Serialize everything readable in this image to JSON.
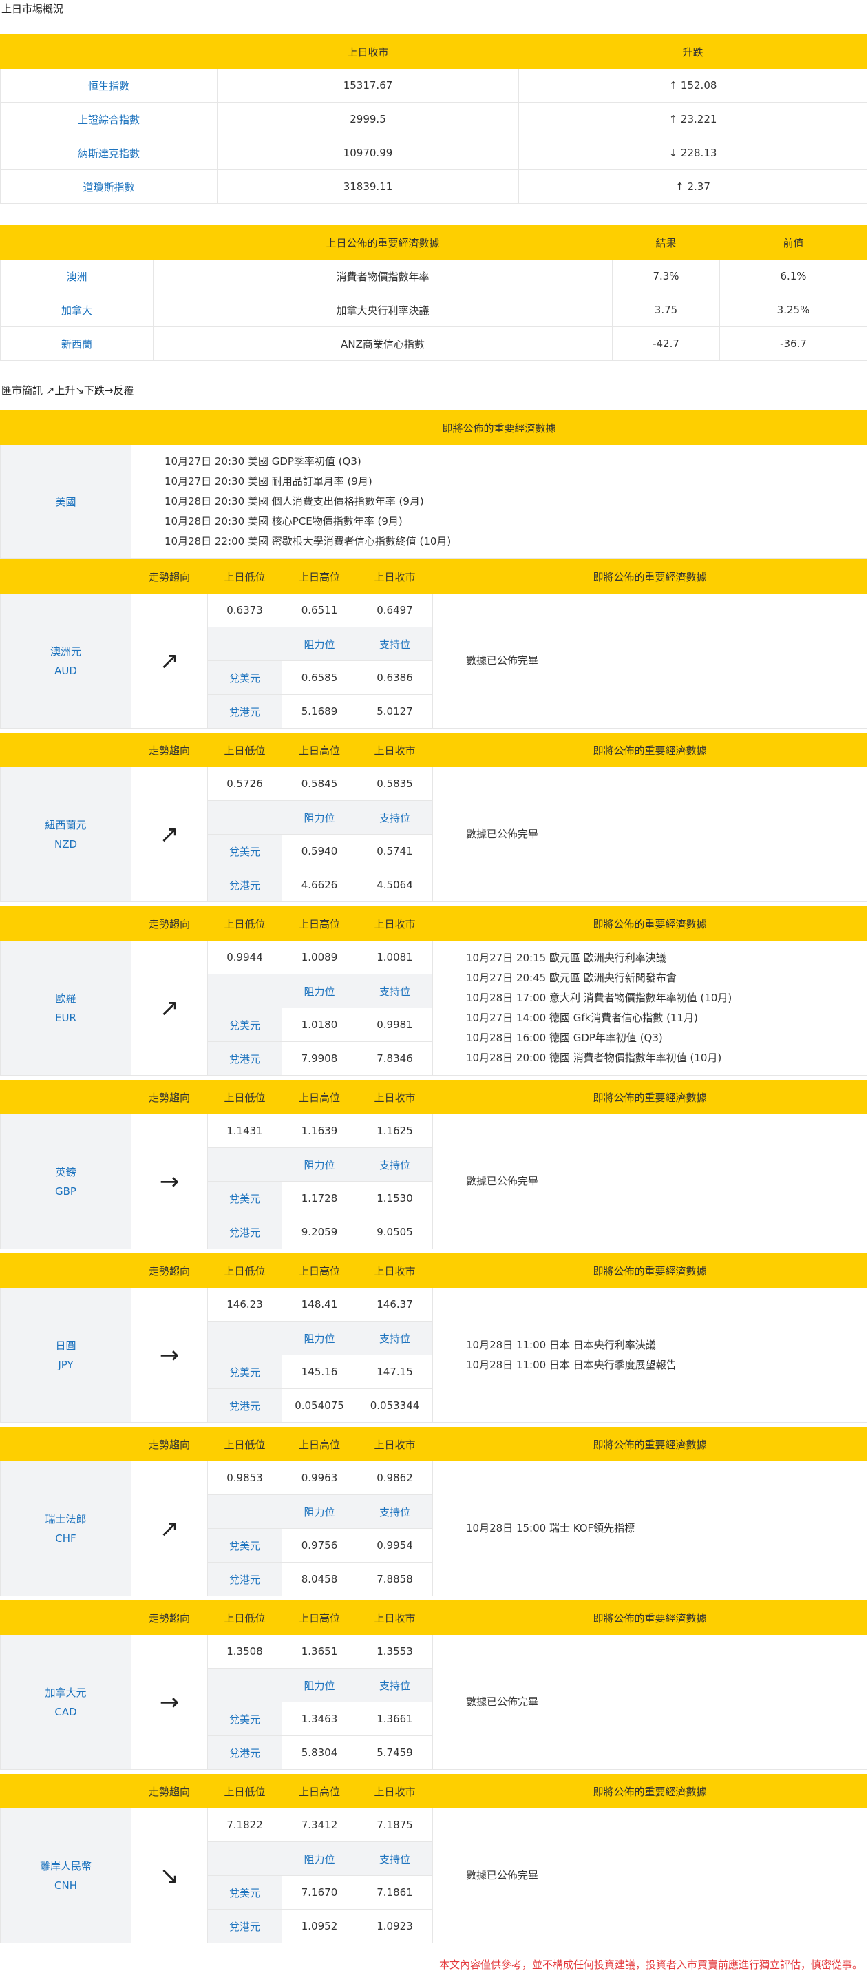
{
  "market": {
    "title": "上日市場概況",
    "headers": [
      "",
      "上日收市",
      "升跌"
    ],
    "rows": [
      {
        "name": "恒生指數",
        "close": "15317.67",
        "change": "↑ 152.08"
      },
      {
        "name": "上證綜合指數",
        "close": "2999.5",
        "change": "↑ 23.221"
      },
      {
        "name": "納斯達克指數",
        "close": "10970.99",
        "change": "↓ 228.13"
      },
      {
        "name": "道瓊斯指數",
        "close": "31839.11",
        "change": "↑ 2.37"
      }
    ]
  },
  "econ": {
    "headers": [
      "",
      "上日公佈的重要經濟數據",
      "結果",
      "前值"
    ],
    "rows": [
      {
        "country": "澳洲",
        "item": "消費者物價指數年率",
        "result": "7.3%",
        "prev": "6.1%"
      },
      {
        "country": "加拿大",
        "item": "加拿大央行利率決議",
        "result": "3.75",
        "prev": "3.25%"
      },
      {
        "country": "新西蘭",
        "item": "ANZ商業信心指數",
        "result": "-42.7",
        "prev": "-36.7"
      }
    ]
  },
  "fx": {
    "title": "匯市簡訊 ↗上升↘下跌→反覆",
    "upcoming_header": "即將公佈的重要經濟數據",
    "us": {
      "label": "美國",
      "events": [
        "10月27日 20:30  美國 GDP季率初值 (Q3)",
        "10月27日 20:30  美國 耐用品訂單月率 (9月)",
        "10月28日 20:30  美國 個人消費支出價格指數年率 (9月)",
        "10月28日 20:30  美國 核心PCE物價指數年率 (9月)",
        "10月28日 22:00  美國 密歇根大學消費者信心指數終值 (10月)"
      ]
    },
    "col_headers": [
      "走勢趨向",
      "上日低位",
      "上日高位",
      "上日收市",
      "即將公佈的重要經濟數據"
    ],
    "sub_headers": [
      "阻力位",
      "支持位"
    ],
    "row_labels": [
      "兌美元",
      "兌港元"
    ],
    "currencies": [
      {
        "name": "澳洲元",
        "code": "AUD",
        "trend": "↗",
        "low": "0.6373",
        "high": "0.6511",
        "close": "0.6497",
        "usd_res": "0.6585",
        "usd_sup": "0.6386",
        "hkd_res": "5.1689",
        "hkd_sup": "5.0127",
        "events": [
          "數據已公佈完畢"
        ]
      },
      {
        "name": "紐西蘭元",
        "code": "NZD",
        "trend": "↗",
        "low": "0.5726",
        "high": "0.5845",
        "close": "0.5835",
        "usd_res": "0.5940",
        "usd_sup": "0.5741",
        "hkd_res": "4.6626",
        "hkd_sup": "4.5064",
        "events": [
          "數據已公佈完畢"
        ]
      },
      {
        "name": "歐羅",
        "code": "EUR",
        "trend": "↗",
        "low": "0.9944",
        "high": "1.0089",
        "close": "1.0081",
        "usd_res": "1.0180",
        "usd_sup": "0.9981",
        "hkd_res": "7.9908",
        "hkd_sup": "7.8346",
        "events": [
          "10月27日 20:15  歐元區 歐洲央行利率決議",
          "10月27日 20:45  歐元區 歐洲央行新聞發布會",
          "10月28日 17:00  意大利 消費者物價指數年率初值 (10月)",
          "10月27日 14:00  德國 Gfk消費者信心指數 (11月)",
          "10月28日 16:00  德國 GDP年率初值 (Q3)",
          "10月28日 20:00  德國 消費者物價指數年率初值 (10月)"
        ]
      },
      {
        "name": "英鎊",
        "code": "GBP",
        "trend": "→",
        "low": "1.1431",
        "high": "1.1639",
        "close": "1.1625",
        "usd_res": "1.1728",
        "usd_sup": "1.1530",
        "hkd_res": "9.2059",
        "hkd_sup": "9.0505",
        "events": [
          "數據已公佈完畢"
        ]
      },
      {
        "name": "日圓",
        "code": "JPY",
        "trend": "→",
        "low": "146.23",
        "high": "148.41",
        "close": "146.37",
        "usd_res": "145.16",
        "usd_sup": "147.15",
        "hkd_res": "0.054075",
        "hkd_sup": "0.053344",
        "events": [
          "10月28日 11:00  日本 日本央行利率決議",
          "10月28日 11:00  日本 日本央行季度展望報告"
        ]
      },
      {
        "name": "瑞士法郎",
        "code": "CHF",
        "trend": "↗",
        "low": "0.9853",
        "high": "0.9963",
        "close": "0.9862",
        "usd_res": "0.9756",
        "usd_sup": "0.9954",
        "hkd_res": "8.0458",
        "hkd_sup": "7.8858",
        "events": [
          "10月28日 15:00 瑞士 KOF領先指標"
        ]
      },
      {
        "name": "加拿大元",
        "code": "CAD",
        "trend": "→",
        "low": "1.3508",
        "high": "1.3651",
        "close": "1.3553",
        "usd_res": "1.3463",
        "usd_sup": "1.3661",
        "hkd_res": "5.8304",
        "hkd_sup": "5.7459",
        "events": [
          "數據已公佈完畢"
        ]
      },
      {
        "name": "離岸人民幣",
        "code": "CNH",
        "trend": "↘",
        "low": "7.1822",
        "high": "7.3412",
        "close": "7.1875",
        "usd_res": "7.1670",
        "usd_sup": "7.1861",
        "hkd_res": "1.0952",
        "hkd_sup": "1.0923",
        "events": [
          "數據已公佈完畢"
        ]
      }
    ]
  },
  "footer": "本文內容僅供參考，並不構成任何投資建議，投資者入市買賣前應進行獨立評估，慎密從事。"
}
